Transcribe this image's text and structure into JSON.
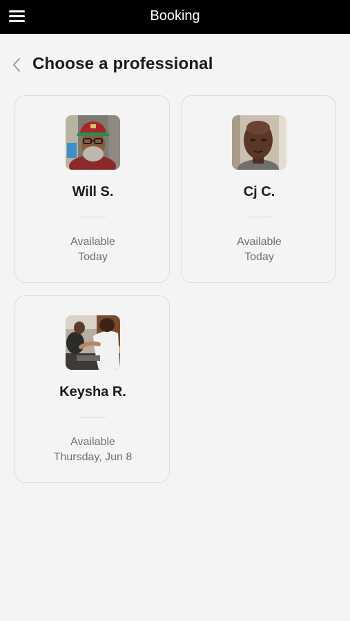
{
  "header": {
    "title": "Booking",
    "menu_icon": "hamburger-menu-icon"
  },
  "page": {
    "back_icon": "chevron-left-icon",
    "title": "Choose a professional"
  },
  "professionals": [
    {
      "name": "Will S.",
      "availability_label": "Available",
      "availability_when": "Today"
    },
    {
      "name": "Cj C.",
      "availability_label": "Available",
      "availability_when": "Today"
    },
    {
      "name": "Keysha R.",
      "availability_label": "Available",
      "availability_when": "Thursday, Jun 8"
    }
  ]
}
